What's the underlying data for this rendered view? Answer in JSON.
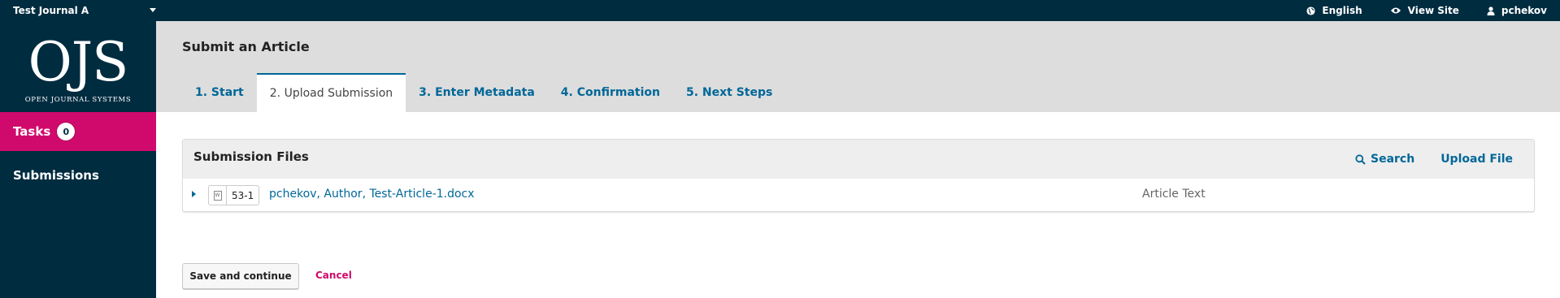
{
  "topbar": {
    "journal": "Test Journal A",
    "language": "English",
    "view_site": "View Site",
    "user": "pchekov"
  },
  "sidebar": {
    "logo_mark": "OJS",
    "logo_sub": "OPEN JOURNAL SYSTEMS",
    "tasks_label": "Tasks",
    "tasks_count": "0",
    "submissions_label": "Submissions"
  },
  "header": {
    "title": "Submit an Article",
    "tabs": [
      {
        "label": "1. Start"
      },
      {
        "label": "2. Upload Submission"
      },
      {
        "label": "3. Enter Metadata"
      },
      {
        "label": "4. Confirmation"
      },
      {
        "label": "5. Next Steps"
      }
    ],
    "active_tab": 1
  },
  "panel": {
    "title": "Submission Files",
    "search_label": "Search",
    "upload_label": "Upload File",
    "files": [
      {
        "type_icon": "W",
        "id": "53-1",
        "name": "pchekov, Author, Test-Article-1.docx",
        "genre": "Article Text"
      }
    ]
  },
  "actions": {
    "save_label": "Save and continue",
    "cancel_label": "Cancel"
  },
  "colors": {
    "navy": "#002c40",
    "accent_pink": "#d00a6c",
    "link_blue": "#006798",
    "header_gray": "#dddddd"
  }
}
